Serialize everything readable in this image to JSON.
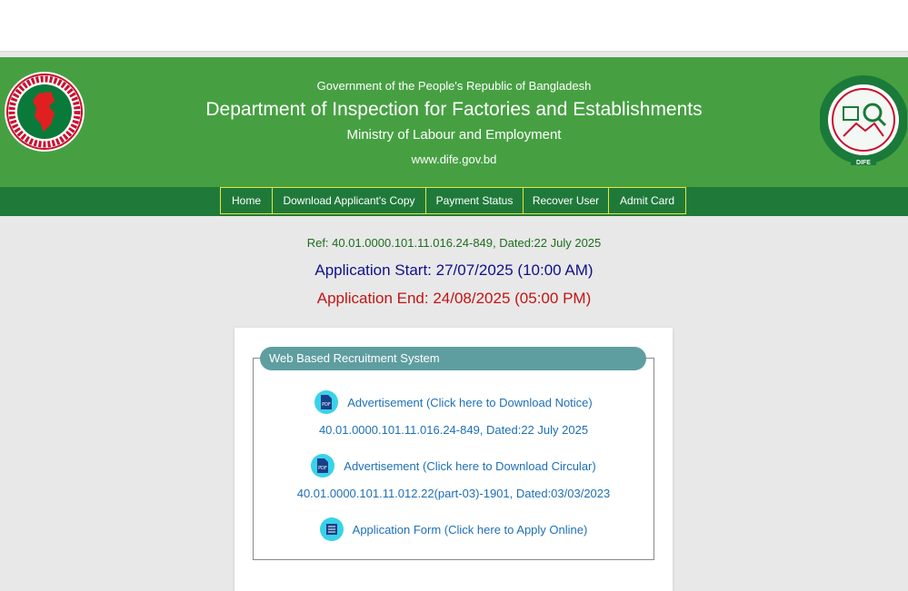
{
  "header": {
    "gov_line": "Government of the People's Republic of Bangladesh",
    "dept_name": "Department of Inspection for Factories and Establishments",
    "ministry": "Ministry of Labour and Employment",
    "website": "www.dife.gov.bd",
    "logo_right_text": "DIFE"
  },
  "nav": {
    "items": [
      {
        "label": "Home"
      },
      {
        "label": "Download Applicant's Copy"
      },
      {
        "label": "Payment Status"
      },
      {
        "label": "Recover User"
      },
      {
        "label": "Admit Card"
      }
    ]
  },
  "notice": {
    "ref": "Ref: 40.01.0000.101.11.016.24-849, Dated:22 July 2025",
    "start": "Application Start: 27/07/2025 (10:00 AM)",
    "end": "Application End: 24/08/2025 (05:00 PM)"
  },
  "panel": {
    "title": "Web Based Recruitment System",
    "links": [
      {
        "label": "Advertisement (Click here to Download Notice)",
        "memo": "40.01.0000.101.11.016.24-849, Dated:22 July 2025",
        "icon": "pdf-icon"
      },
      {
        "label": "Advertisement (Click here to Download Circular)",
        "memo": "40.01.0000.101.11.012.22(part-03)-1901, Dated:03/03/2023",
        "icon": "pdf-icon"
      },
      {
        "label": "Application Form (Click here to Apply Online)",
        "icon": "form-icon"
      }
    ]
  },
  "colors": {
    "header_green": "#46a042",
    "nav_green": "#1f7a3a",
    "nav_border": "#e6e63a",
    "link_blue": "#1e6fb5",
    "start_blue": "#10108a",
    "end_red": "#c01515",
    "legend_teal": "#5f9ea0"
  }
}
